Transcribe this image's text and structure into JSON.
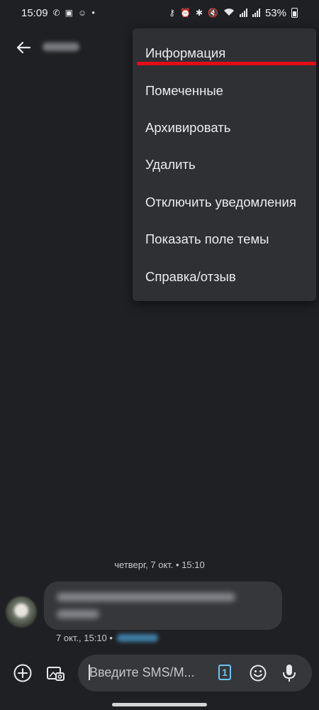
{
  "status_bar": {
    "time": "15:09",
    "battery": "53%",
    "left_icons": [
      "mute-call-icon",
      "gallery-icon",
      "accessibility-icon",
      "dot-icon"
    ],
    "right_icons": [
      "key-icon",
      "alarm-icon",
      "bluetooth-icon",
      "mute-icon",
      "wifi-icon",
      "signal-icon",
      "signal-icon",
      "battery-icon"
    ]
  },
  "menu": {
    "items": [
      "Информация",
      "Помеченные",
      "Архивировать",
      "Удалить",
      "Отключить уведомления",
      "Показать поле темы",
      "Справка/отзыв"
    ],
    "highlighted_item": "Информация",
    "annotation_color": "#e30d17"
  },
  "conversation": {
    "date_separator": "четверг, 7 окт. • 15:10",
    "message_time": "7 окт., 15:10 •"
  },
  "compose": {
    "placeholder": "Введите SMS/M...",
    "sim_number": "1",
    "accent_color": "#6bc4ef"
  }
}
